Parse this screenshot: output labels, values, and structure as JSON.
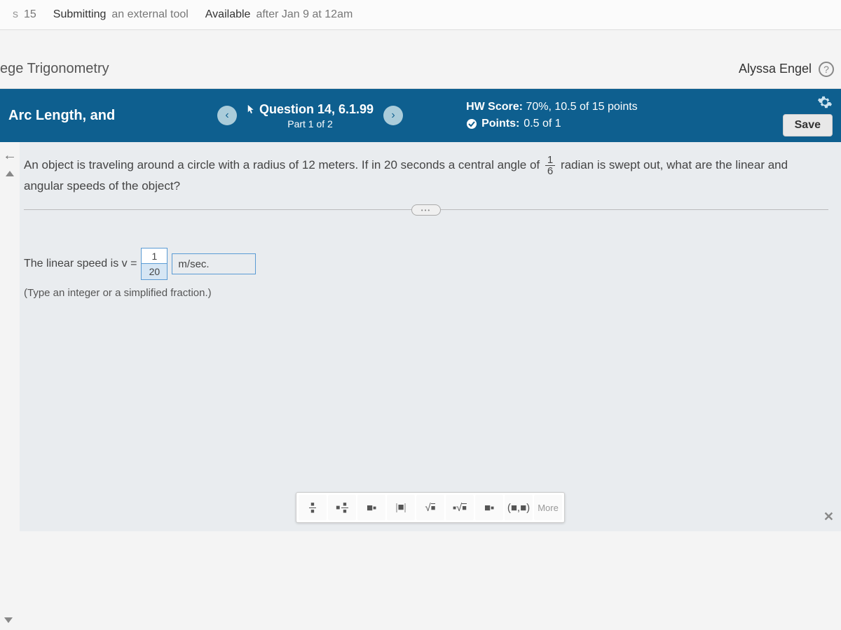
{
  "topbar": {
    "points_partial": "s",
    "points_value": "15",
    "submitting_label": "Submitting",
    "submitting_value": "an external tool",
    "available_label": "Available",
    "available_value": "after Jan 9 at 12am"
  },
  "course": {
    "title_partial": "ege Trigonometry",
    "user_name": "Alyssa Engel"
  },
  "bluebar": {
    "section": "Arc Length, and",
    "question_label": "Question 14, 6.1.99",
    "part_label": "Part 1 of 2",
    "hw_score_label": "HW Score:",
    "hw_score_value": "70%, 10.5 of 15 points",
    "points_label": "Points:",
    "points_value": "0.5 of 1",
    "save_label": "Save"
  },
  "question": {
    "text_before_frac": "An object is traveling around a circle with a radius of 12 meters. If in 20 seconds a central angle of ",
    "frac_num": "1",
    "frac_den": "6",
    "text_after_frac": " radian is swept out, what are the linear and angular speeds of the object?"
  },
  "answer": {
    "label": "The linear speed is v =",
    "num": "1",
    "den": "20",
    "unit": "m/sec.",
    "hint": "(Type an integer or a simplified fraction.)"
  },
  "toolbar": {
    "more": "More",
    "subscript": "■",
    "ordered_pair": "(■,■)"
  }
}
